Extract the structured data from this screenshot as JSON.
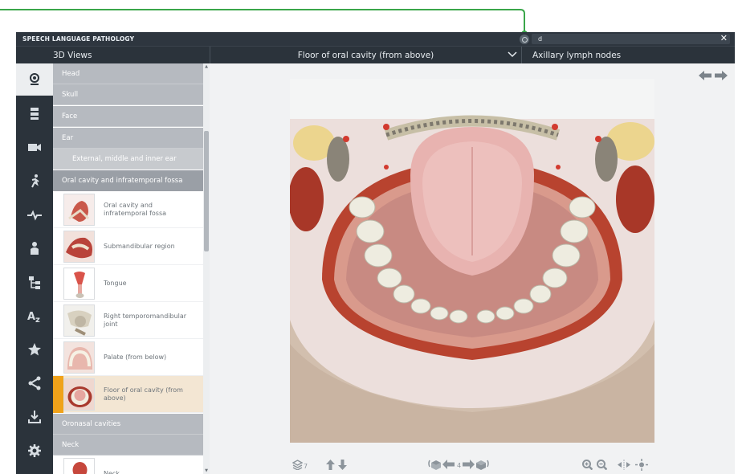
{
  "app": {
    "title": "SPEECH LANGUAGE PATHOLOGY",
    "accent_color": "#3aa64a",
    "highlight_color": "#f0a21a"
  },
  "search": {
    "value": "d",
    "clear_icon": "close-icon"
  },
  "header": {
    "views_label": "3D Views",
    "model_title": "Floor of oral cavity (from above)",
    "related_label": "Axillary lymph nodes"
  },
  "nav_rail": {
    "items": [
      {
        "icon": "head-model-icon",
        "active": true
      },
      {
        "icon": "layers-icon",
        "active": false
      },
      {
        "icon": "video-camera-icon",
        "active": false
      },
      {
        "icon": "running-figure-icon",
        "active": false
      },
      {
        "icon": "heartbeat-icon",
        "active": false
      },
      {
        "icon": "patient-icon",
        "active": false
      },
      {
        "icon": "hierarchy-icon",
        "active": false
      },
      {
        "icon": "alphabetical-index-icon",
        "active": false
      },
      {
        "icon": "star-icon",
        "active": false
      },
      {
        "icon": "share-icon",
        "active": false
      },
      {
        "icon": "download-icon",
        "active": false
      },
      {
        "icon": "settings-icon",
        "active": false
      }
    ]
  },
  "list": {
    "categories_top": [
      "Head",
      "Skull",
      "Face",
      "Ear"
    ],
    "sub_category": "External, middle and inner ear",
    "open_category": "Oral cavity and infratemporal fossa",
    "items": [
      {
        "label": "Oral cavity and infratemporal fossa",
        "selected": false
      },
      {
        "label": "Submandibular region",
        "selected": false
      },
      {
        "label": "Tongue",
        "selected": false
      },
      {
        "label": "Right temporomandibular joint",
        "selected": false
      },
      {
        "label": "Palate (from below)",
        "selected": false
      },
      {
        "label": "Floor of oral cavity (from above)",
        "selected": true
      }
    ],
    "categories_bottom": [
      "Oronasal cavities",
      "Neck"
    ],
    "last_item": {
      "label": "Neck"
    }
  },
  "toolbar": {
    "layers_count": "7",
    "views_count": "4"
  }
}
